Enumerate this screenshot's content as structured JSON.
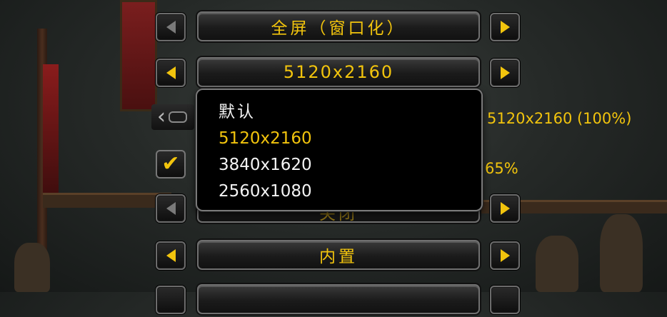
{
  "colors": {
    "accent": "#f2c40d",
    "panel": "#000000",
    "border": "#7a7a7a",
    "text": "#f4f4f4"
  },
  "display_mode": {
    "value": "全屏（窗口化）"
  },
  "resolution": {
    "value": "5120x2160"
  },
  "dropdown": {
    "items": [
      {
        "label": "默认",
        "selected": false
      },
      {
        "label": "5120x2160",
        "selected": true
      },
      {
        "label": "3840x1620",
        "selected": false
      },
      {
        "label": "2560x1080",
        "selected": false
      }
    ]
  },
  "render_scale": {
    "readout": "5120x2160 (100%)"
  },
  "gamma": {
    "readout": "65%"
  },
  "vsync": {
    "value": "关闭"
  },
  "gpu": {
    "value": "内置"
  },
  "icons": {
    "prev": "triangle-left-icon",
    "next": "triangle-right-icon",
    "check": "checkmark-icon",
    "slider_prev": "chevron-left-icon"
  }
}
